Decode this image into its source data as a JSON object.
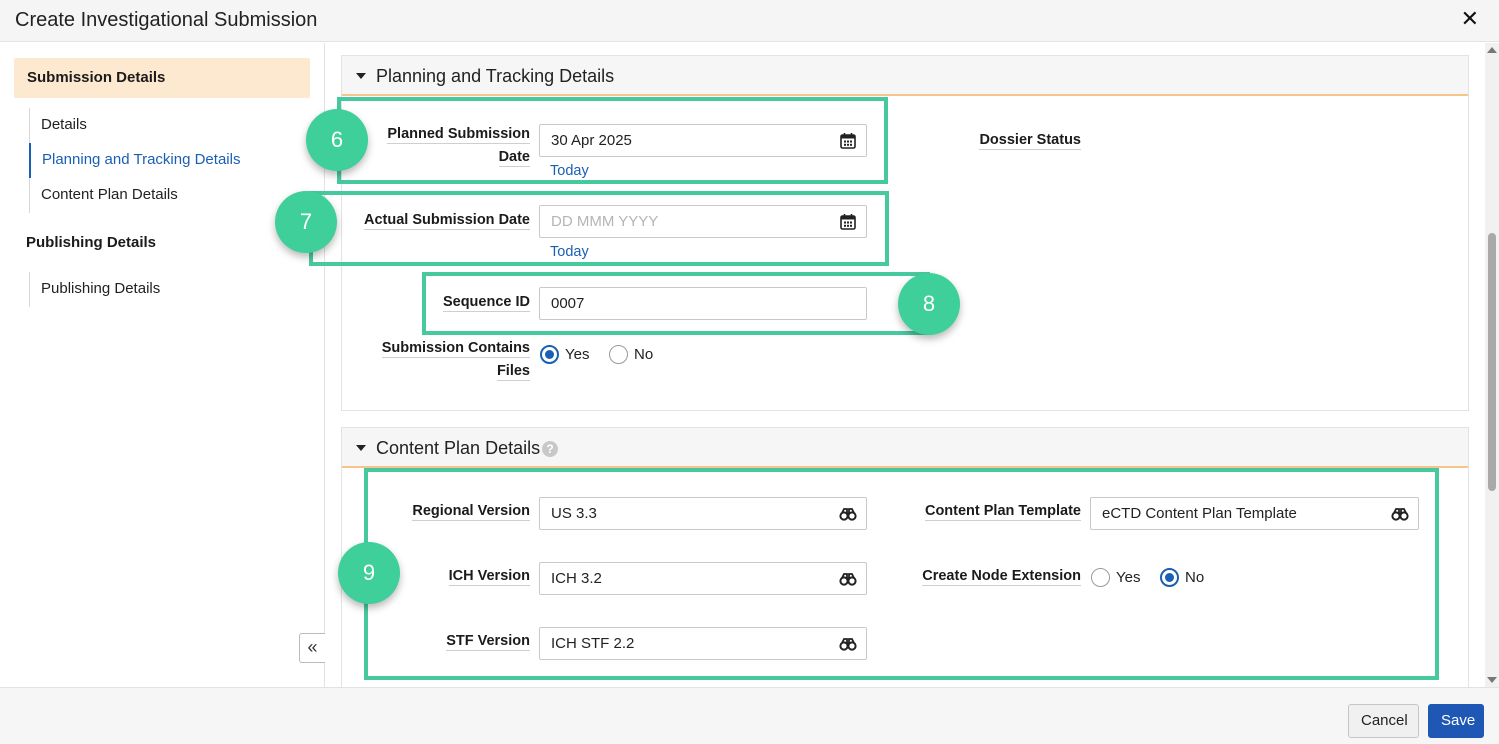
{
  "dialog": {
    "title": "Create Investigational Submission",
    "close_glyph": "✕"
  },
  "sidebar": {
    "groups": [
      {
        "label": "Submission Details",
        "items": [
          "Details",
          "Planning and Tracking Details",
          "Content Plan Details"
        ]
      },
      {
        "label": "Publishing Details",
        "items": [
          "Publishing Details"
        ]
      }
    ],
    "current_item": "Planning and Tracking Details",
    "collapse_glyph": "«"
  },
  "planning": {
    "section_title": "Planning and Tracking Details",
    "planned_label_line1": "Planned Submission",
    "planned_label_line2": "Date",
    "planned_value": "30 Apr 2025",
    "today_link": "Today",
    "actual_label": "Actual Submission Date",
    "actual_placeholder": "DD MMM YYYY",
    "dossier_status_label": "Dossier Status",
    "sequence_label": "Sequence ID",
    "sequence_value": "0007",
    "contains_files_label_line1": "Submission Contains",
    "contains_files_label_line2": "Files",
    "contains_files_options": [
      "Yes",
      "No"
    ],
    "contains_files_selected": "Yes"
  },
  "content_plan": {
    "section_title": "Content Plan Details",
    "help_glyph": "?",
    "regional_label": "Regional Version",
    "regional_value": "US 3.3",
    "ich_label": "ICH Version",
    "ich_value": "ICH 3.2",
    "stf_label": "STF Version",
    "stf_value": "ICH STF 2.2",
    "template_label": "Content Plan Template",
    "template_value": "eCTD Content Plan Template",
    "node_ext_label": "Create Node Extension",
    "node_ext_options": [
      "Yes",
      "No"
    ],
    "node_ext_selected": "No"
  },
  "callouts": [
    "6",
    "7",
    "8",
    "9"
  ],
  "footer": {
    "cancel_label": "Cancel",
    "save_label": "Save"
  },
  "colors": {
    "accent_blue": "#1a5fb4",
    "callout_green": "#3ecf9b",
    "section_underline": "#f7c48c",
    "active_group_bg": "#fde9cf"
  },
  "icons": {
    "date_field": "calendar-icon",
    "lookup_field": "binoculars-icon"
  }
}
